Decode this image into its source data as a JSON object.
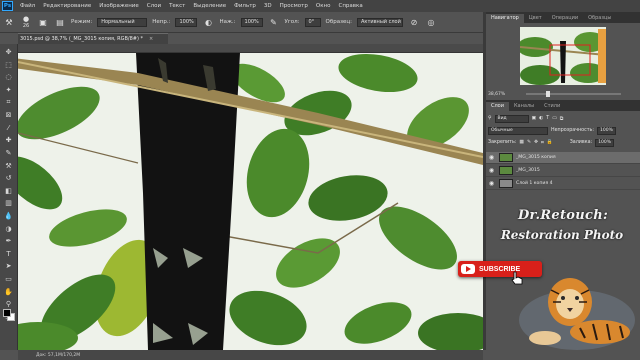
{
  "menubar": {
    "logo": "Ps",
    "items": [
      "Файл",
      "Редактирование",
      "Изображение",
      "Слои",
      "Текст",
      "Выделение",
      "Фильтр",
      "3D",
      "Просмотр",
      "Окно",
      "Справка"
    ]
  },
  "options_bar": {
    "brush_size": "26",
    "mode_label": "Режим:",
    "mode_value": "Нормальный",
    "opacity_label": "Непр.:",
    "opacity_value": "100%",
    "flow_label": "Наж.:",
    "flow_value": "100%",
    "smooth_label": "Угол:",
    "smooth_value": "0°",
    "sample_label": "Образец:",
    "sample_value": "Активный слой"
  },
  "document": {
    "tab_title": "3015.psd @ 38,7% (_MG_3015 копия, RGB/8#) *",
    "close": "×",
    "status": "Док: 57,1М/170,2М"
  },
  "navigator": {
    "tabs": [
      "Навигатор",
      "Цвет",
      "Операции",
      "Образцы"
    ],
    "zoom": "38,67%"
  },
  "layers": {
    "tabs": [
      "Слои",
      "Каналы",
      "Стили"
    ],
    "filter_label": "Вид",
    "blend_mode": "Обычные",
    "opacity_label": "Непрозрачность:",
    "opacity_value": "100%",
    "lock_label": "Закрепить:",
    "fill_label": "Заливка:",
    "fill_value": "100%",
    "items": [
      {
        "name": "_MG_3015 копия",
        "visible": true,
        "selected": true
      },
      {
        "name": "_MG_3015",
        "visible": true,
        "selected": false
      },
      {
        "name": "Слой 1 копия 4",
        "visible": true,
        "selected": false
      }
    ]
  },
  "watermark": {
    "title": "Dr.Retouch:",
    "subtitle": "Restoration Photo",
    "subscribe_label": "SUBSCRIBE"
  },
  "icons": {
    "eye": "eye-icon",
    "youtube": "youtube-play-icon",
    "hand_cursor": "hand-cursor-icon"
  },
  "colors": {
    "ui_dark": "#434343",
    "ui_mid": "#535353",
    "subscribe_red": "#d8201a",
    "ps_blue": "#31a8ff",
    "foreground": "#000000",
    "background": "#ffffff"
  }
}
